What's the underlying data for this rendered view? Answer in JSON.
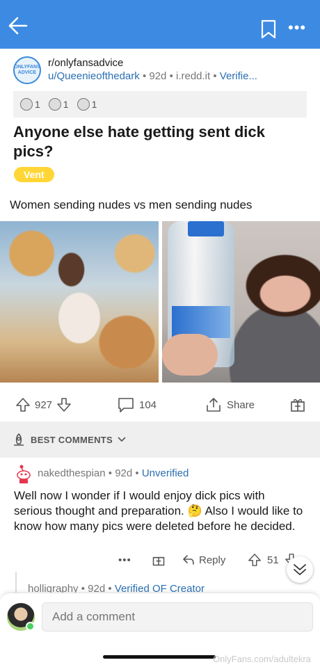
{
  "header": {
    "back_icon": "arrow-left-icon",
    "bookmark_icon": "bookmark-icon",
    "more_label": "•••",
    "accent": "#3d8ae3"
  },
  "post": {
    "logo_text": [
      "ONLYFANS",
      "ADVICE"
    ],
    "subreddit": "r/onlyfansadvice",
    "author": "u/Queenieofthedark",
    "age": "92d",
    "domain": "i.redd.it",
    "verified": "Verifie...",
    "awards": [
      {
        "count": "1"
      },
      {
        "count": "1"
      },
      {
        "count": "1"
      }
    ],
    "title": "Anyone else hate getting sent dick pics?",
    "flair": "Vent",
    "flair_color": "#ffd635",
    "body": "Women sending nudes vs men sending nudes",
    "upvotes": "927",
    "comments": "104",
    "share_label": "Share"
  },
  "comments_header": {
    "label": "BEST COMMENTS"
  },
  "comment": {
    "author": "nakedthespian",
    "age": "92d",
    "status": "Unverified",
    "text": "Well now I wonder if I would enjoy dick pics with serious thought and preparation. 🤔  Also I would like to know how many pics were deleted before he decided.",
    "more_label": "•••",
    "reply_label": "Reply",
    "votes": "51"
  },
  "sub_comment": {
    "author": "holligraphy",
    "age": "92d",
    "status": "Verified OF Creator"
  },
  "composer": {
    "placeholder": "Add a comment"
  },
  "watermark": "OnlyFans.com/adultekra"
}
